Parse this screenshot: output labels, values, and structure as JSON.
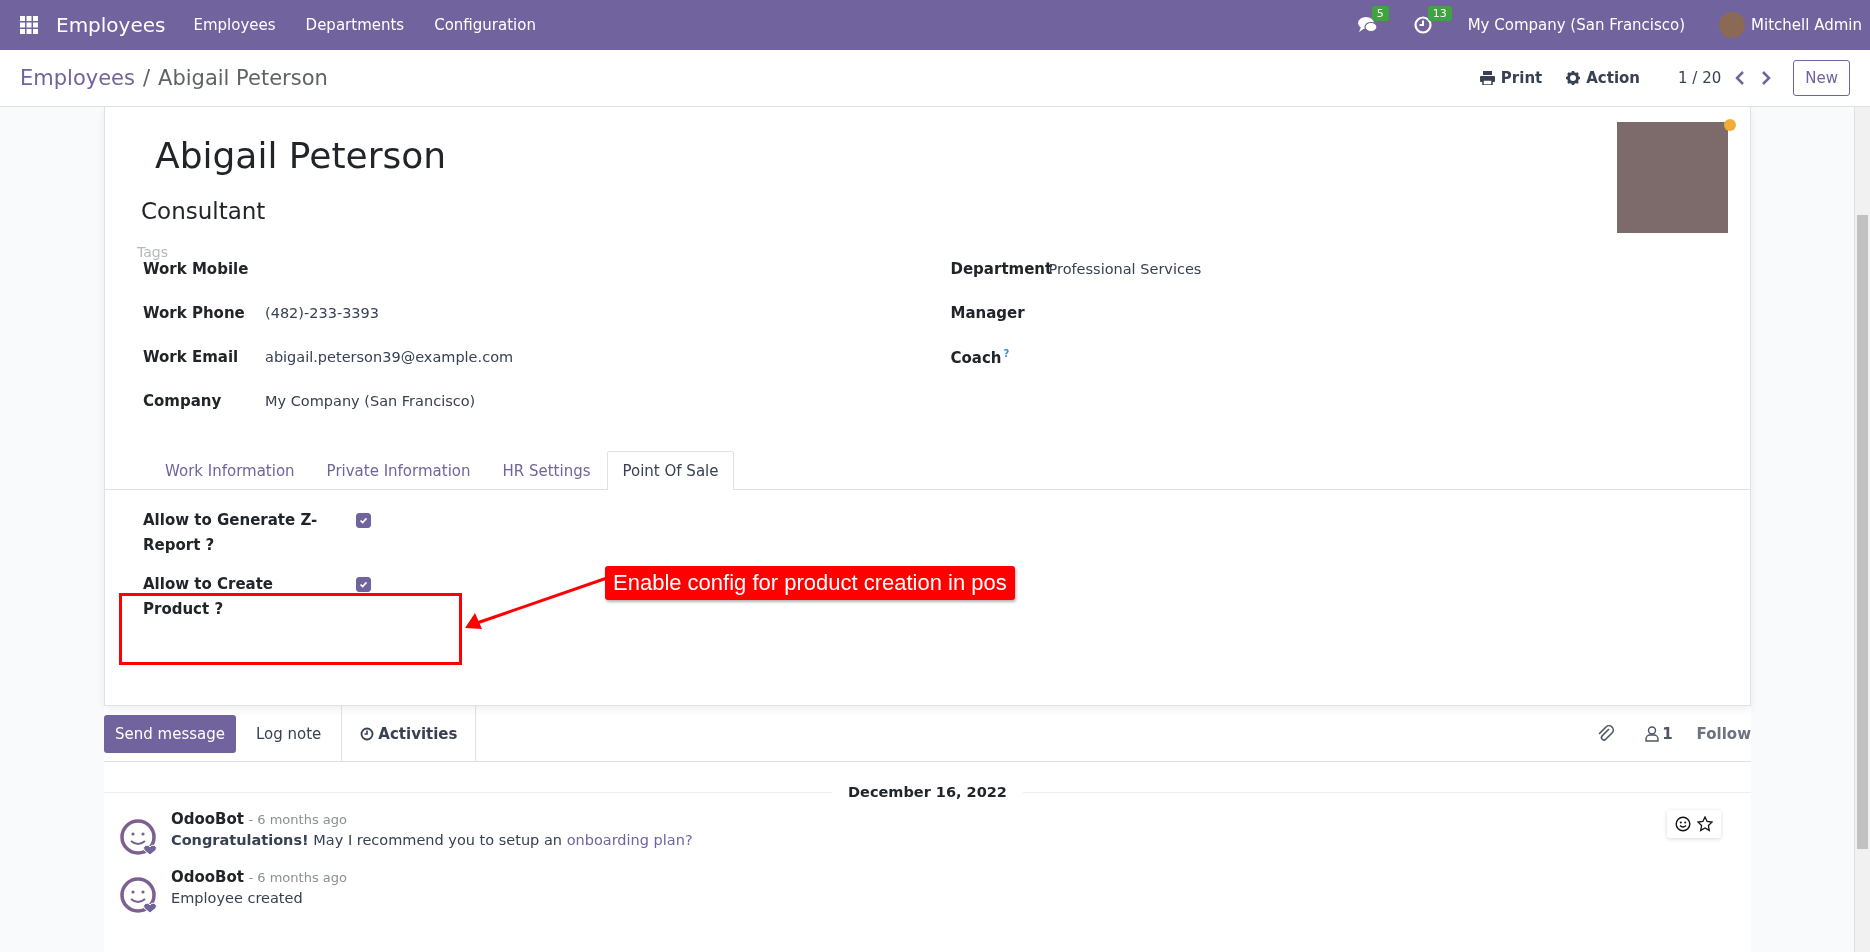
{
  "navbar": {
    "app": "Employees",
    "menus": [
      "Employees",
      "Departments",
      "Configuration"
    ],
    "messages_badge": "5",
    "activities_badge": "13",
    "company": "My Company (San Francisco)",
    "user": "Mitchell Admin"
  },
  "control_panel": {
    "breadcrumb": [
      "Employees",
      "Abigail Peterson"
    ],
    "separator": "/",
    "print": "Print",
    "action": "Action",
    "pager": "1 / 20",
    "new_button": "New"
  },
  "employee": {
    "name": "Abigail Peterson",
    "job_title": "Consultant",
    "tags_placeholder": "Tags",
    "away": true,
    "left_fields": [
      {
        "label": "Work Mobile"
      },
      {
        "label": "Work Phone",
        "value": "(482)-233-3393"
      },
      {
        "label": "Work Email",
        "value": "abigail.peterson39@example.com"
      },
      {
        "label": "Company",
        "value": "My Company (San Francisco)"
      }
    ],
    "right_fields": [
      {
        "label": "Department",
        "value": "Professional Services"
      },
      {
        "label": "Manager"
      },
      {
        "label": "Coach",
        "help": "?"
      }
    ],
    "tabs": [
      {
        "label": "Work Information",
        "selected": false
      },
      {
        "label": "Private Information",
        "selected": false
      },
      {
        "label": "HR Settings",
        "selected": false
      },
      {
        "label": "Point Of Sale",
        "selected": true
      }
    ],
    "pos_settings": [
      {
        "label": "Allow to Generate Z-Report ?",
        "checked": true
      },
      {
        "label": "Allow to Create Product ?",
        "checked": true
      }
    ]
  },
  "annotation": {
    "text": "Enable config for product creation in pos"
  },
  "chatter": {
    "send_message": "Send message",
    "log_note": "Log note",
    "activities": "Activities",
    "followers": "1",
    "follow": "Follow",
    "date": "December 16, 2022",
    "messages": [
      {
        "author": "OdooBot",
        "time": "- 6 months ago",
        "body": "**Congratulations!** May I recommend you to setup an ",
        "link": "onboarding plan?"
      },
      {
        "author": "OdooBot",
        "time": "- 6 months ago",
        "body": "Employee created"
      }
    ]
  }
}
